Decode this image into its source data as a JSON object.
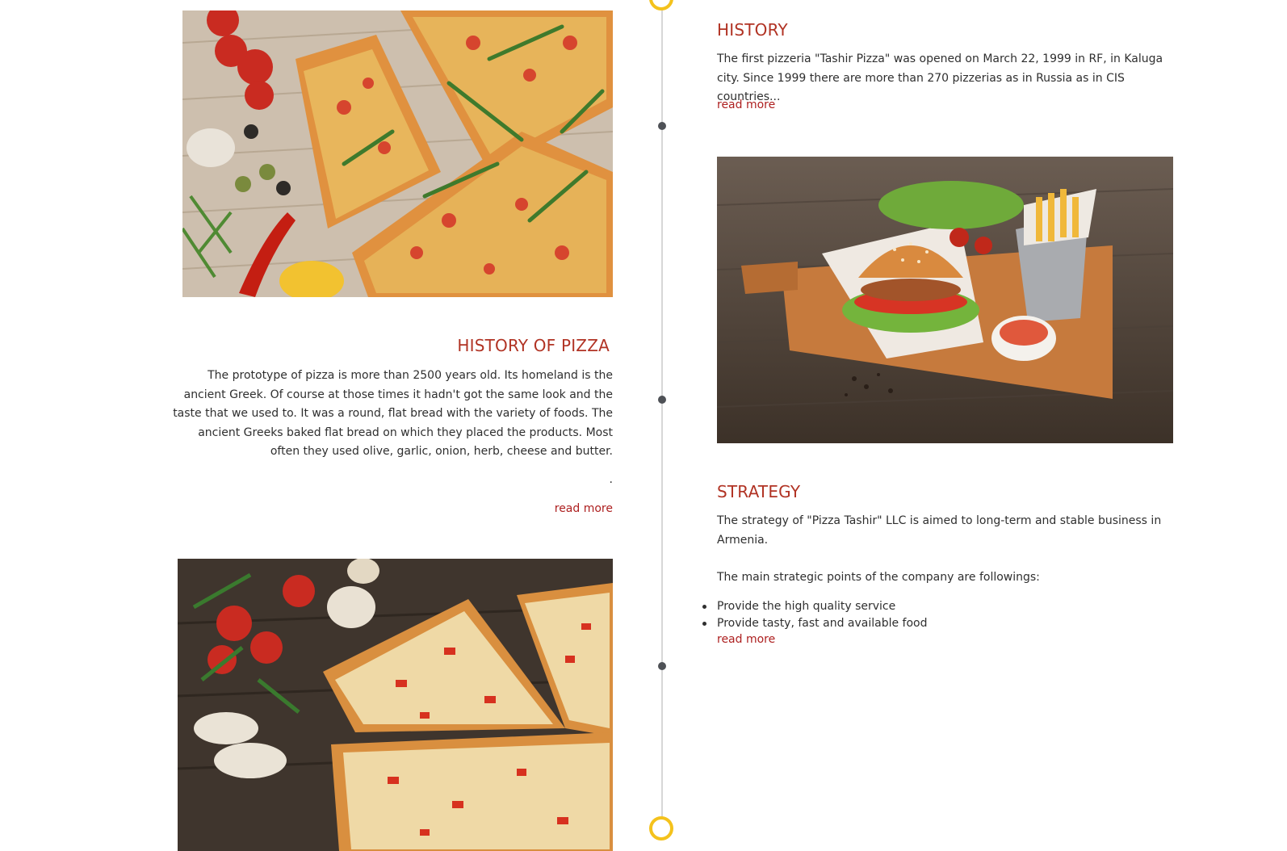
{
  "history": {
    "title": "HISTORY",
    "text": "The first pizzeria \"Tashir Pizza\" was opened on March 22, 1999 in RF, in  Kaluga city. Since 1999 there are more than 270 pizzerias as in Russia as in CIS countries...",
    "read_more": "read more"
  },
  "history_of_pizza": {
    "title": "HISTORY OF PIZZA",
    "text": "The prototype of pizza is more than 2500 years old. Its homeland is the ancient Greek. Of course at those times it hadn't got the same look and the taste that we used to. It was a round, flat bread with the variety of foods. The ancient Greeks baked flat bread on which they placed the products. Most often they used olive, garlic, onion, herb, cheese and butter.",
    "dot": ".",
    "read_more": "read more"
  },
  "strategy": {
    "title": "STRATEGY",
    "text": "The strategy of \"Pizza Tashir\" LLC is aimed to long-term and stable business in Armenia.",
    "points_intro": "The main strategic points of the company are followings:",
    "points": [
      "Provide the high quality service",
      "Provide tasty, fast and available food"
    ],
    "read_more": "read more"
  },
  "colors": {
    "accent_heading": "#b13324",
    "link": "#ad1f1f",
    "timeline_ring": "#f4c21c",
    "timeline_dot": "#4e5156",
    "timeline_line": "#d7d7d7"
  },
  "images": {
    "top_left": "pizza-slices-photo",
    "right": "burger-and-fries-photo",
    "bottom_left": "cheese-pizza-photo"
  }
}
